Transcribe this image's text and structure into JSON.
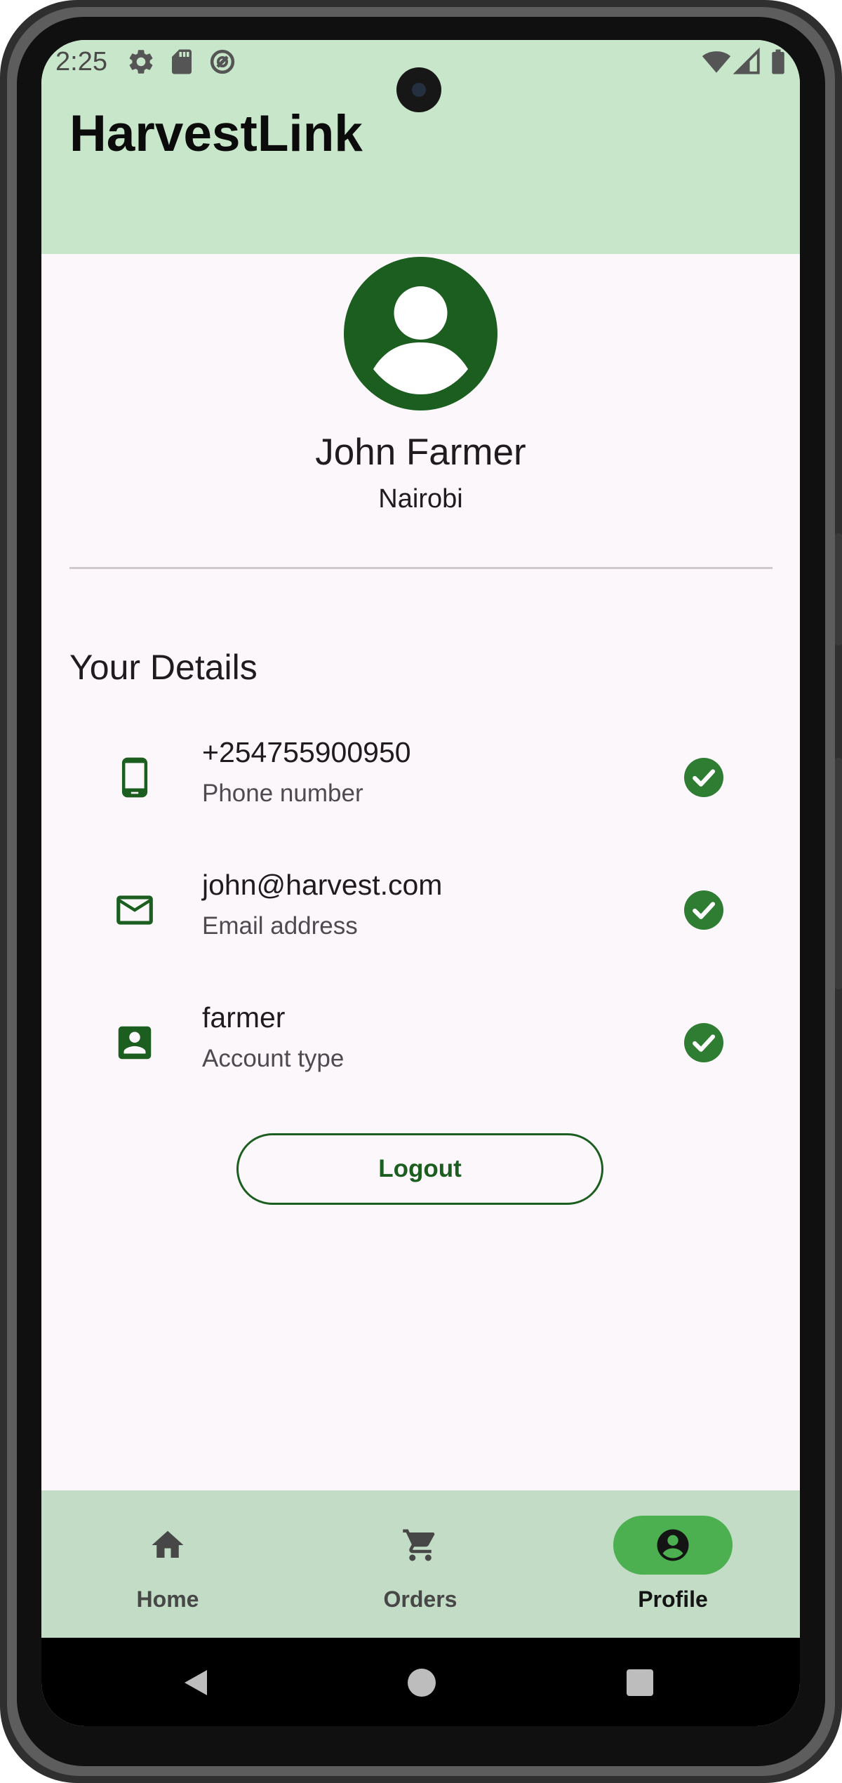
{
  "status_bar": {
    "time": "2:25",
    "left_icons": [
      "settings-icon",
      "sd-card-icon",
      "sync-icon"
    ],
    "right_icons": [
      "wifi-icon",
      "signal-icon",
      "battery-icon"
    ]
  },
  "app_bar": {
    "title": "HarvestLink"
  },
  "profile": {
    "name": "John Farmer",
    "location": "Nairobi",
    "avatar_icon": "account-circle-icon"
  },
  "details": {
    "section_title": "Your Details",
    "items": [
      {
        "icon": "smartphone-icon",
        "value": "+254755900950",
        "label": "Phone number",
        "status_icon": "check-circle-icon"
      },
      {
        "icon": "email-icon",
        "value": "john@harvest.com",
        "label": "Email address",
        "status_icon": "check-circle-icon"
      },
      {
        "icon": "account-box-icon",
        "value": "farmer",
        "label": "Account type",
        "status_icon": "check-circle-icon"
      }
    ]
  },
  "logout_button": {
    "label": "Logout"
  },
  "bottom_nav": {
    "items": [
      {
        "label": "Home",
        "icon": "home-icon",
        "active": false
      },
      {
        "label": "Orders",
        "icon": "shopping-cart-icon",
        "active": false
      },
      {
        "label": "Profile",
        "icon": "account-circle-icon",
        "active": true
      }
    ]
  },
  "colors": {
    "primary": "#1b5e20",
    "check": "#2e7d32",
    "app_bar": "#c8e6c9",
    "nav_bar": "#c2dcc5",
    "nav_indicator": "#4caf50",
    "surface": "#fcf7fb"
  }
}
